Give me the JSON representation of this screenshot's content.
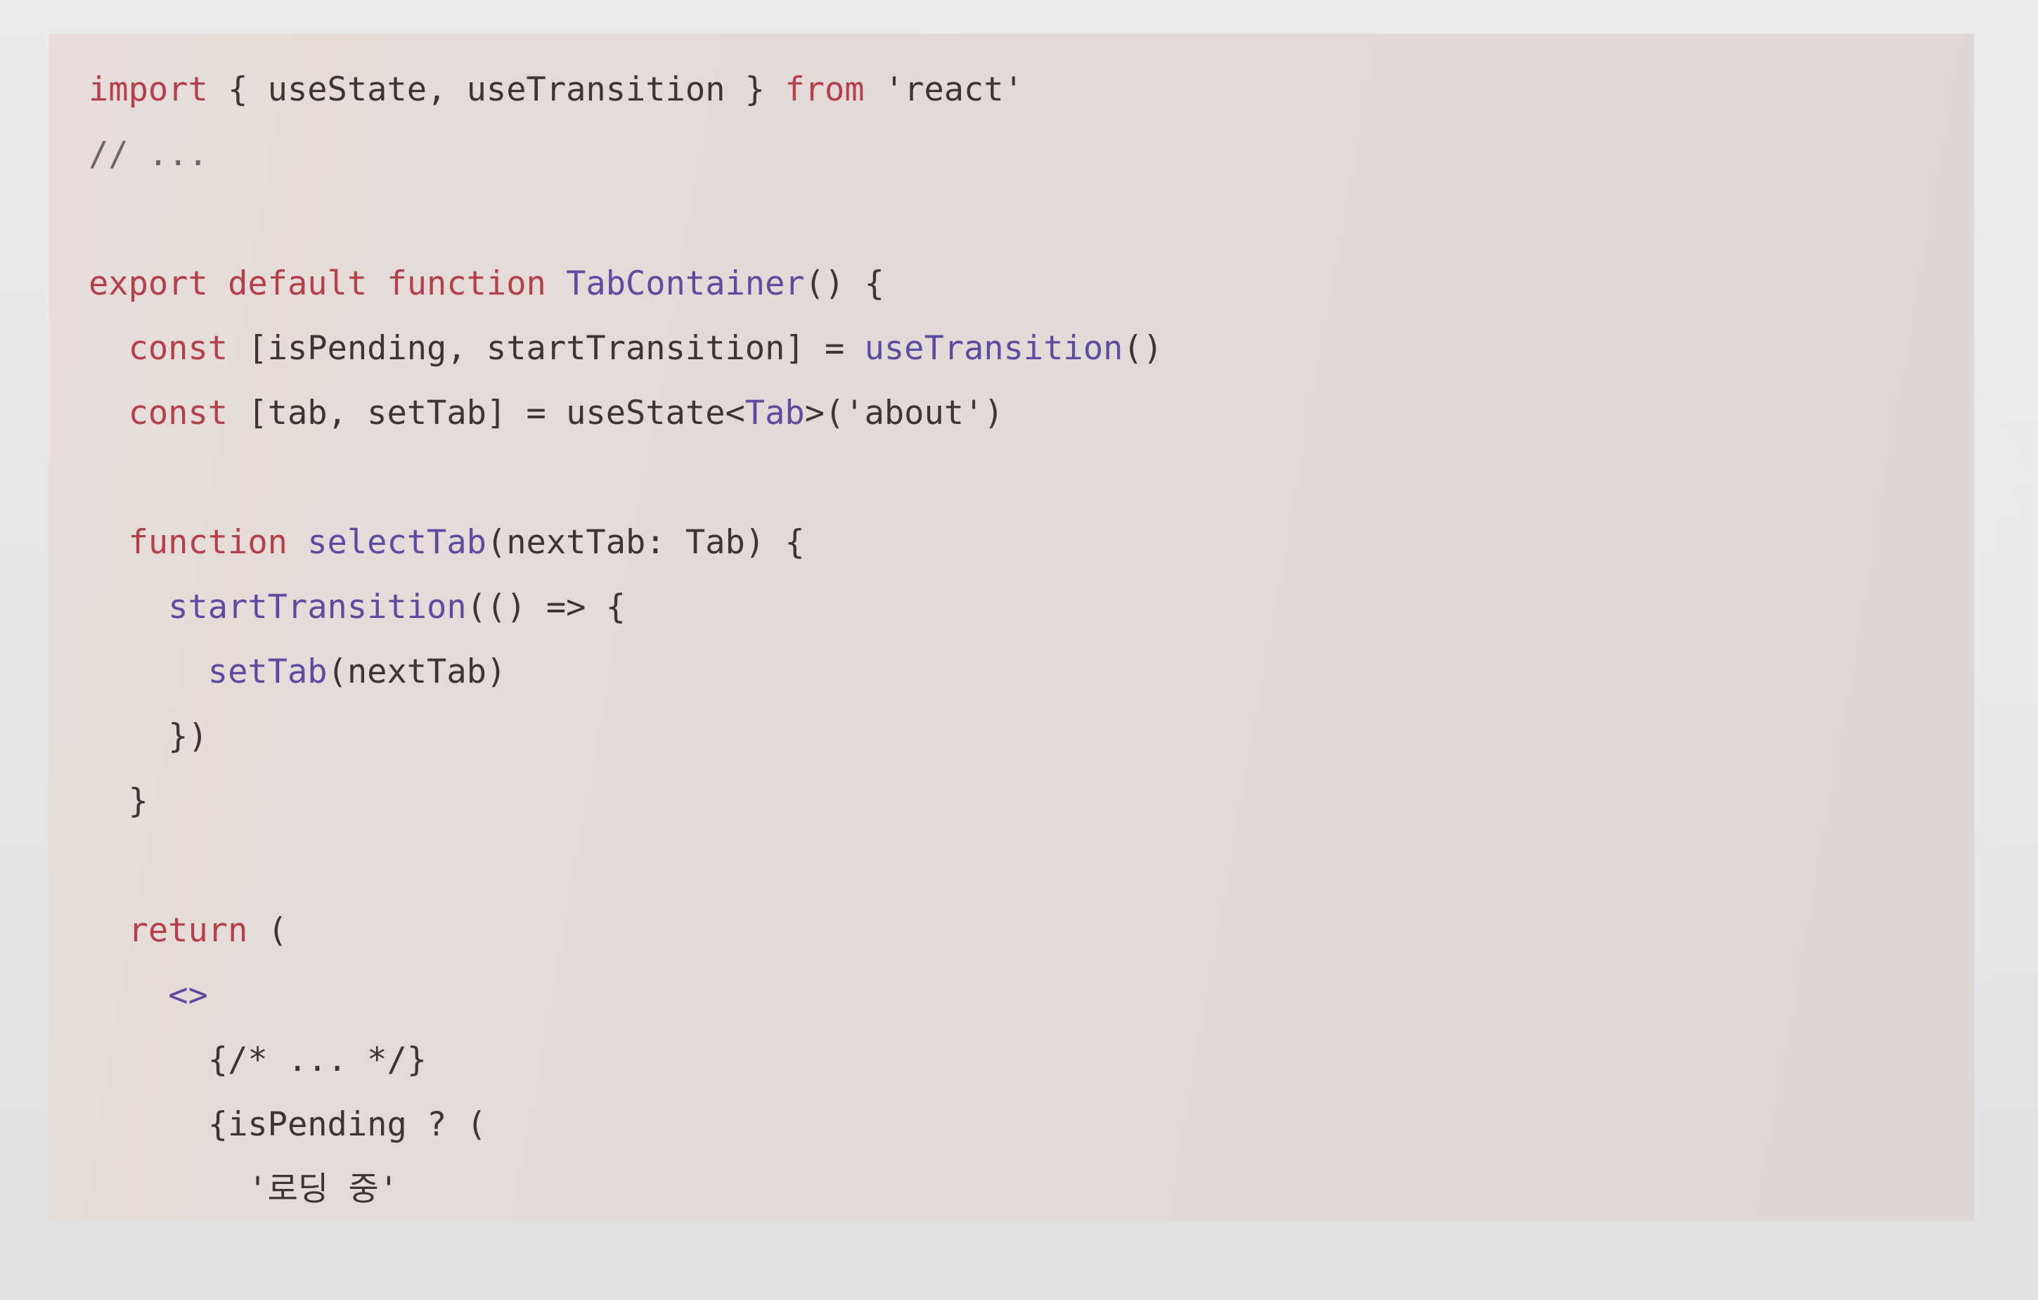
{
  "code_block": {
    "lines": [
      {
        "indent": "",
        "tokens": [
          {
            "t": "import",
            "k": "kw"
          },
          {
            "t": " { useState, useTransition } ",
            "k": "plain"
          },
          {
            "t": "from",
            "k": "kw"
          },
          {
            "t": " 'react'",
            "k": "str"
          }
        ]
      },
      {
        "indent": "",
        "tokens": [
          {
            "t": "// ...",
            "k": "cm"
          }
        ]
      },
      {
        "indent": "",
        "tokens": []
      },
      {
        "indent": "",
        "tokens": [
          {
            "t": "export",
            "k": "kw"
          },
          {
            "t": " ",
            "k": "plain"
          },
          {
            "t": "default",
            "k": "kw"
          },
          {
            "t": " ",
            "k": "plain"
          },
          {
            "t": "function",
            "k": "kw"
          },
          {
            "t": " ",
            "k": "plain"
          },
          {
            "t": "TabContainer",
            "k": "fn"
          },
          {
            "t": "() {",
            "k": "plain"
          }
        ]
      },
      {
        "indent": "  ",
        "tokens": [
          {
            "t": "const",
            "k": "kw"
          },
          {
            "t": " [isPending, startTransition] = ",
            "k": "plain"
          },
          {
            "t": "useTransition",
            "k": "fn"
          },
          {
            "t": "()",
            "k": "plain"
          }
        ]
      },
      {
        "indent": "  ",
        "tokens": [
          {
            "t": "const",
            "k": "kw"
          },
          {
            "t": " [tab, setTab] = useState<",
            "k": "plain"
          },
          {
            "t": "Tab",
            "k": "fn"
          },
          {
            "t": ">('about')",
            "k": "plain"
          }
        ]
      },
      {
        "indent": "",
        "tokens": []
      },
      {
        "indent": "  ",
        "tokens": [
          {
            "t": "function",
            "k": "kw"
          },
          {
            "t": " ",
            "k": "plain"
          },
          {
            "t": "selectTab",
            "k": "fn"
          },
          {
            "t": "(nextTab: Tab) {",
            "k": "plain"
          }
        ]
      },
      {
        "indent": "    ",
        "tokens": [
          {
            "t": "startTransition",
            "k": "fn"
          },
          {
            "t": "(() => {",
            "k": "plain"
          }
        ]
      },
      {
        "indent": "      ",
        "tokens": [
          {
            "t": "setTab",
            "k": "fn"
          },
          {
            "t": "(nextTab)",
            "k": "plain"
          }
        ]
      },
      {
        "indent": "    ",
        "tokens": [
          {
            "t": "})",
            "k": "plain"
          }
        ]
      },
      {
        "indent": "  ",
        "tokens": [
          {
            "t": "}",
            "k": "plain"
          }
        ]
      },
      {
        "indent": "",
        "tokens": []
      },
      {
        "indent": "  ",
        "tokens": [
          {
            "t": "return",
            "k": "kw"
          },
          {
            "t": " (",
            "k": "plain"
          }
        ]
      },
      {
        "indent": "    ",
        "tokens": [
          {
            "t": "<>",
            "k": "fn"
          }
        ]
      },
      {
        "indent": "      ",
        "tokens": [
          {
            "t": "{/* ... */}",
            "k": "plain"
          }
        ]
      },
      {
        "indent": "      ",
        "tokens": [
          {
            "t": "{isPending ? (",
            "k": "plain"
          }
        ]
      },
      {
        "indent": "        ",
        "tokens": [
          {
            "t": "'로딩 중'",
            "k": "str"
          }
        ]
      }
    ]
  }
}
